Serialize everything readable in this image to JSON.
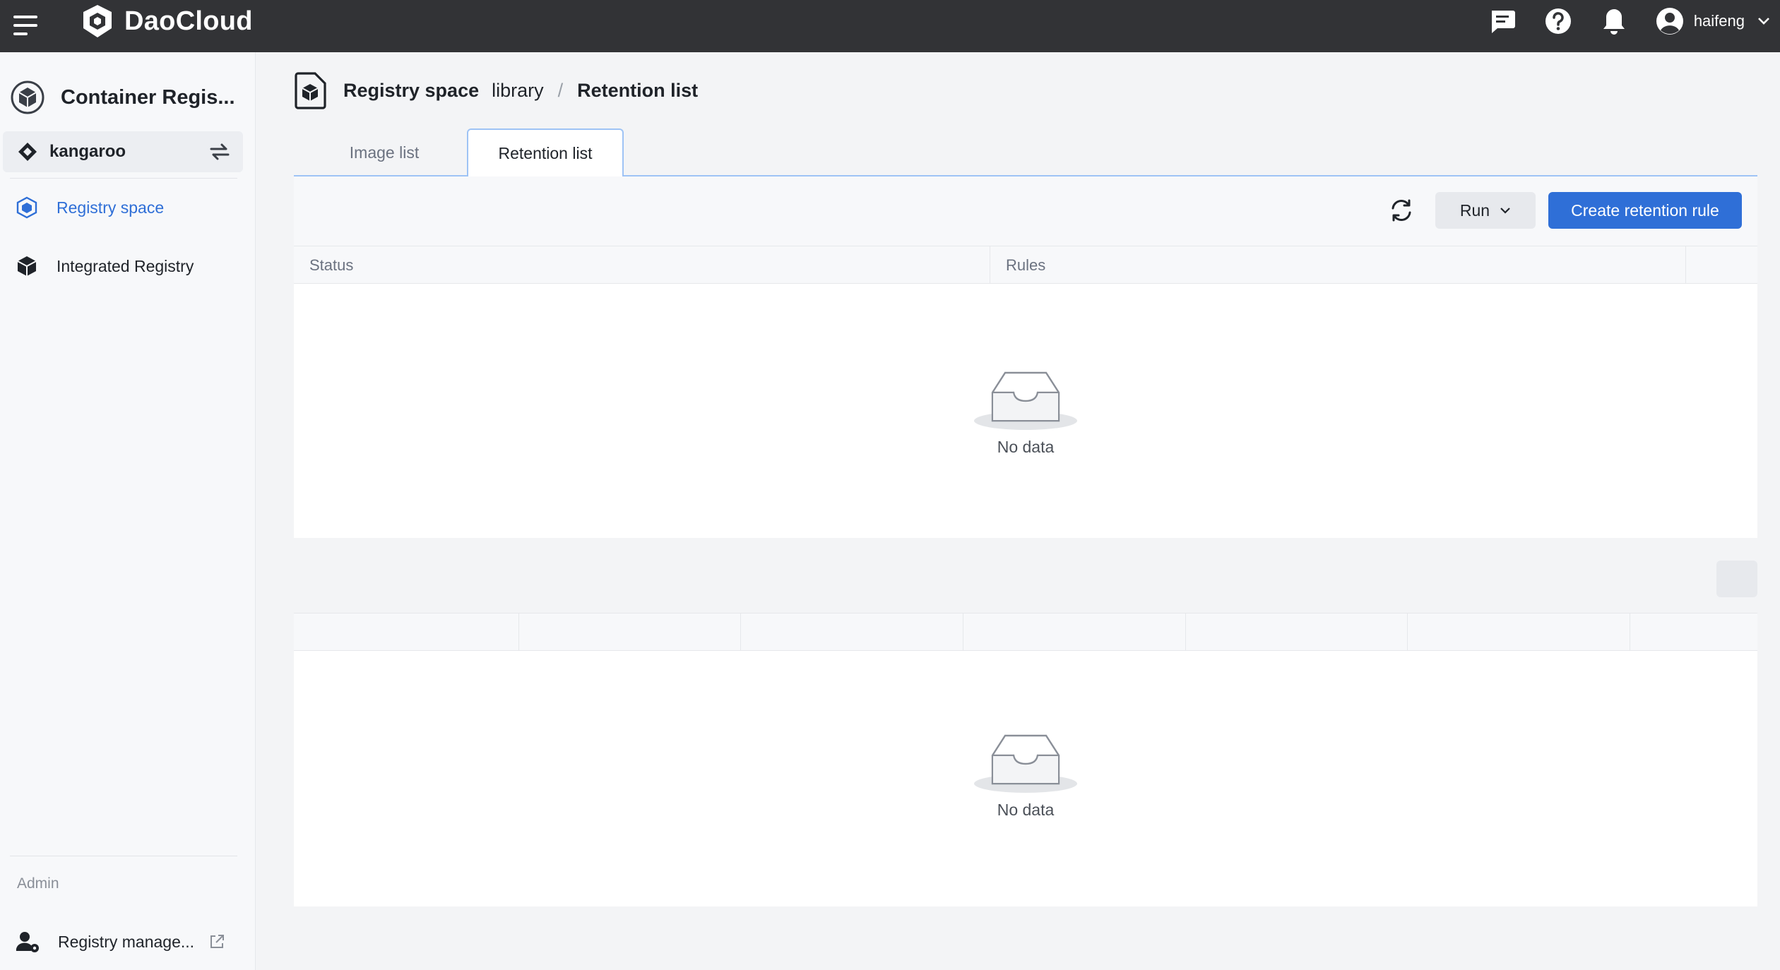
{
  "topbar": {
    "brand": "DaoCloud",
    "user": "haifeng",
    "icons": [
      "menu-icon",
      "message-icon",
      "help-icon",
      "bell-icon",
      "user-avatar-icon",
      "chevron-down-icon"
    ]
  },
  "sidebar": {
    "module_title": "Container Regis...",
    "workspace": "kangaroo",
    "items": [
      {
        "label": "Registry space",
        "icon": "registry-space-icon",
        "active": true
      },
      {
        "label": "Integrated Registry",
        "icon": "integrated-registry-icon",
        "active": false
      }
    ],
    "admin_label": "Admin",
    "admin_item": "Registry manage..."
  },
  "breadcrumb": {
    "section": "Registry space",
    "space": "library",
    "separator": "/",
    "current": "Retention list"
  },
  "tabs": [
    {
      "label": "Image list",
      "active": false
    },
    {
      "label": "Retention list",
      "active": true
    }
  ],
  "toolbar": {
    "run_label": "Run",
    "create_label": "Create retention rule"
  },
  "rules_table": {
    "columns": [
      "Status",
      "Rules",
      ""
    ],
    "empty_text": "No data"
  },
  "history_table": {
    "columns": [
      "",
      "",
      "",
      "",
      "",
      "",
      ""
    ],
    "empty_text": "No data"
  },
  "colors": {
    "topbar": "#323336",
    "primary": "#2f6fd7",
    "tab_border": "#9ec3f5"
  }
}
